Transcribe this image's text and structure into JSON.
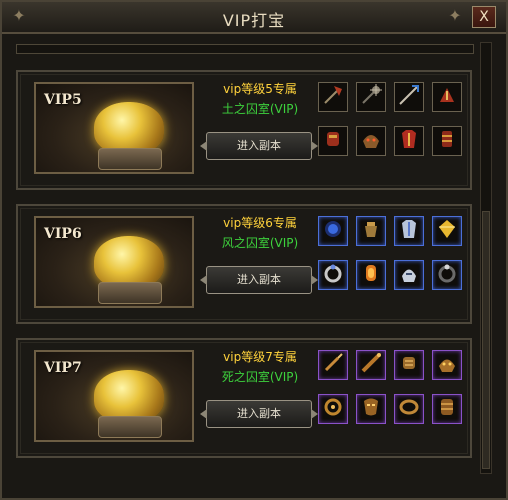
{
  "window": {
    "title": "VIP打宝",
    "close_label": "X"
  },
  "panels": [
    {
      "vip": "VIP5",
      "subtitle": "vip等级5专属",
      "dungeon": "土之囚室(VIP)",
      "dungeon_color": "#3dd23d",
      "button": "进入副本",
      "item_border": "grey",
      "items": [
        "axe-icon",
        "spiked-mace-icon",
        "blade-staff-icon",
        "red-claw-icon",
        "red-gauntlet-icon",
        "demon-helm-icon",
        "red-armor-icon",
        "red-wristguard-icon"
      ]
    },
    {
      "vip": "VIP6",
      "subtitle": "vip等级6专属",
      "dungeon": "风之囚室(VIP)",
      "dungeon_color": "#3dd23d",
      "button": "进入副本",
      "item_border": "blue",
      "items": [
        "blue-orb-icon",
        "bronze-pot-icon",
        "silver-armor-icon",
        "gold-gem-icon",
        "silver-ring-icon",
        "amber-gem-icon",
        "silver-helm-icon",
        "black-ring-icon"
      ]
    },
    {
      "vip": "VIP7",
      "subtitle": "vip等级7专属",
      "dungeon": "死之囚室(VIP)",
      "dungeon_color": "#3dd23d",
      "button": "进入副本",
      "item_border": "purple",
      "items": [
        "bronze-dagger-icon",
        "bronze-rod-icon",
        "bronze-fist-icon",
        "bronze-helm-icon",
        "bronze-ring-icon",
        "bronze-mask-icon",
        "bronze-bracelet-icon",
        "bronze-gauntlet-icon"
      ]
    }
  ]
}
